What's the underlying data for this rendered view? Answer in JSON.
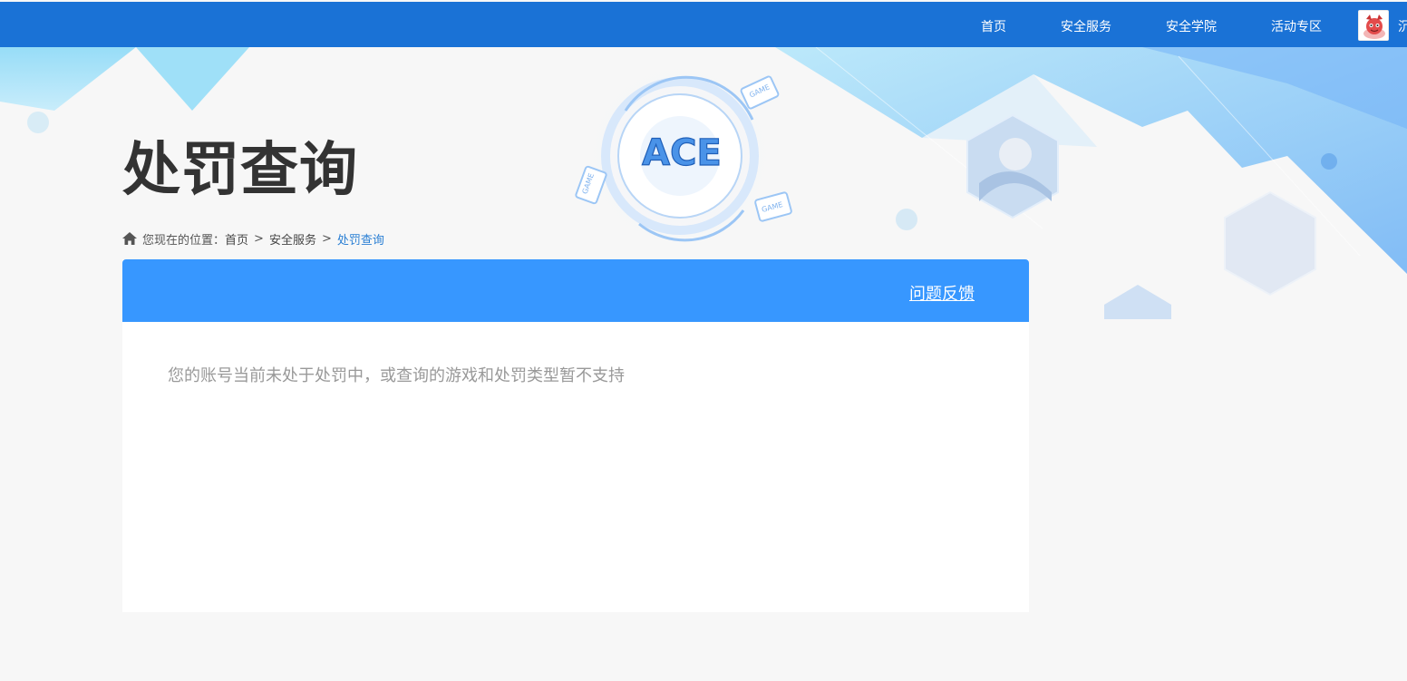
{
  "nav": {
    "items": [
      {
        "label": "首页"
      },
      {
        "label": "安全服务"
      },
      {
        "label": "安全学院"
      },
      {
        "label": "活动专区"
      }
    ],
    "user_name_cut": "沉"
  },
  "page": {
    "title": "处罚查询"
  },
  "breadcrumb": {
    "prefix": "您现在的位置：",
    "items": [
      "首页",
      "安全服务",
      "处罚查询"
    ],
    "separator": ">"
  },
  "card": {
    "feedback_label": "问题反馈",
    "message": "您的账号当前未处于处罚中，或查询的游戏和处罚类型暂不支持"
  },
  "logo": {
    "text": "ACE",
    "badge_text": "GAME"
  },
  "colors": {
    "topbar": "#1a72d6",
    "card_header": "#3797ff",
    "breadcrumb_current": "#2a7fd4",
    "title": "#333333"
  }
}
